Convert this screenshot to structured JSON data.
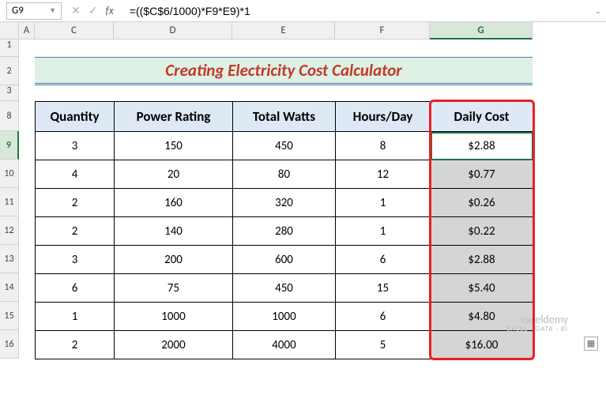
{
  "namebox": "G9",
  "formula": "=(($C$6/1000)*F9*E9)*1",
  "columns": [
    "A",
    "C",
    "D",
    "E",
    "F",
    "G"
  ],
  "rows": [
    "1",
    "2",
    "3",
    "8",
    "9",
    "10",
    "11",
    "12",
    "13",
    "14",
    "15",
    "16"
  ],
  "active_col": "G",
  "active_row": "9",
  "title": "Creating Electricity Cost Calculator",
  "headers": {
    "qty": "Quantity",
    "power": "Power Rating",
    "watts": "Total Watts",
    "hours": "Hours/Day",
    "cost": "Daily Cost"
  },
  "chart_data": {
    "type": "table",
    "title": "Creating Electricity Cost Calculator",
    "columns": [
      "Quantity",
      "Power Rating",
      "Total Watts",
      "Hours/Day",
      "Daily Cost"
    ],
    "rows": [
      {
        "qty": "3",
        "power": "150",
        "watts": "450",
        "hours": "8",
        "cost": "$2.88"
      },
      {
        "qty": "4",
        "power": "20",
        "watts": "80",
        "hours": "12",
        "cost": "$0.77"
      },
      {
        "qty": "2",
        "power": "160",
        "watts": "320",
        "hours": "1",
        "cost": "$0.26"
      },
      {
        "qty": "2",
        "power": "140",
        "watts": "280",
        "hours": "1",
        "cost": "$0.22"
      },
      {
        "qty": "3",
        "power": "200",
        "watts": "600",
        "hours": "6",
        "cost": "$2.88"
      },
      {
        "qty": "6",
        "power": "75",
        "watts": "450",
        "hours": "15",
        "cost": "$5.40"
      },
      {
        "qty": "1",
        "power": "1000",
        "watts": "1000",
        "hours": "6",
        "cost": "$4.80"
      },
      {
        "qty": "2",
        "power": "2000",
        "watts": "4000",
        "hours": "5",
        "cost": "$16.00"
      }
    ]
  },
  "watermark": {
    "main": "exceldemy",
    "sub": "EXCEL · DATA · BI"
  },
  "icons": {
    "dropdown": "▼",
    "cancel": "✕",
    "confirm": "✓",
    "fx": "fx",
    "expand": "⌄",
    "fill": "▦"
  }
}
